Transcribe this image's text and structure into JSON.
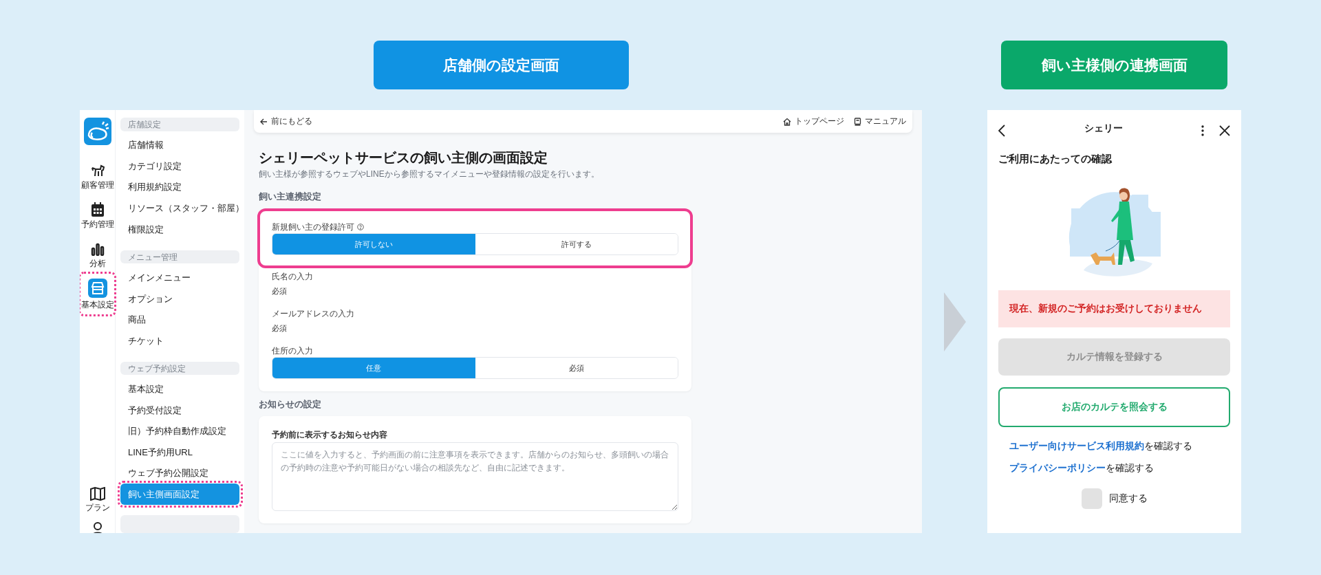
{
  "headings": [
    {
      "label": "店舗側の設定画面",
      "color": "#1093e3"
    },
    {
      "label": "飼い主様側の連携画面",
      "color": "#0aa86a"
    }
  ],
  "admin": {
    "rail": {
      "items": [
        {
          "label": "顧客管理",
          "selected": false,
          "highlighted": false
        },
        {
          "label": "予約管理",
          "selected": false,
          "highlighted": false
        },
        {
          "label": "分析",
          "selected": false,
          "highlighted": false
        },
        {
          "label": "基本設定",
          "selected": true,
          "highlighted": true
        }
      ],
      "bottom": [
        {
          "label": "プラン",
          "selected": false
        }
      ]
    },
    "menu": [
      {
        "title": "店舗設定",
        "items": [
          {
            "label": "店舗情報",
            "selected": false
          },
          {
            "label": "カテゴリ設定",
            "selected": false
          },
          {
            "label": "利用規約設定",
            "selected": false
          },
          {
            "label": "リソース（スタッフ・部屋）",
            "selected": false
          },
          {
            "label": "権限設定",
            "selected": false
          }
        ]
      },
      {
        "title": "メニュー管理",
        "items": [
          {
            "label": "メインメニュー",
            "selected": false
          },
          {
            "label": "オプション",
            "selected": false
          },
          {
            "label": "商品",
            "selected": false
          },
          {
            "label": "チケット",
            "selected": false
          }
        ]
      },
      {
        "title": "ウェブ予約設定",
        "items": [
          {
            "label": "基本設定",
            "selected": false
          },
          {
            "label": "予約受付設定",
            "selected": false
          },
          {
            "label": "旧）予約枠自動作成設定",
            "selected": false
          },
          {
            "label": "LINE予約用URL",
            "selected": false
          },
          {
            "label": "ウェブ予約公開設定",
            "selected": false
          },
          {
            "label": "飼い主側画面設定",
            "selected": true,
            "highlighted": true
          }
        ]
      }
    ],
    "topbar": {
      "back": "前にもどる",
      "links": [
        "トップページ",
        "マニュアル"
      ]
    },
    "page": {
      "title": "シェリーペットサービスの飼い主側の画面設定",
      "description": "飼い主様が参照するウェブやLINEから参照するマイメニューや登録情報の設定を行います。"
    },
    "sections": [
      {
        "title": "飼い主連携設定",
        "fields": [
          {
            "kind": "segmented",
            "label": "新規飼い主の登録許可",
            "help": true,
            "highlighted": true,
            "options": [
              {
                "label": "許可しない",
                "selected": true
              },
              {
                "label": "許可する",
                "selected": false
              }
            ]
          },
          {
            "kind": "static",
            "label": "氏名の入力",
            "value": "必須"
          },
          {
            "kind": "static",
            "label": "メールアドレスの入力",
            "value": "必須"
          },
          {
            "kind": "segmented",
            "label": "住所の入力",
            "options": [
              {
                "label": "任意",
                "selected": true
              },
              {
                "label": "必須",
                "selected": false
              }
            ]
          }
        ]
      },
      {
        "title": "お知らせの設定",
        "fields": [
          {
            "kind": "textarea",
            "label": "予約前に表示するお知らせ内容",
            "placeholder": "ここに値を入力すると、予約画面の前に注意事項を表示できます。店舗からのお知らせ、多頭飼いの場合の予約時の注意や予約可能日がない場合の相談先など、自由に記述できます。"
          }
        ]
      }
    ]
  },
  "phone": {
    "title": "シェリー",
    "heading": "ご利用にあたっての確認",
    "alert": "現在、新規のご予約はお受けしておりません",
    "buttons": [
      {
        "label": "カルテ情報を登録する",
        "disabled": true
      },
      {
        "label": "お店のカルテを照会する",
        "disabled": false
      }
    ],
    "links": [
      {
        "link": "ユーザー向けサービス利用規約",
        "text": "を確認する"
      },
      {
        "link": "プライバシーポリシー",
        "text": "を確認する"
      }
    ],
    "agree": {
      "label": "同意する",
      "checked": false
    }
  }
}
